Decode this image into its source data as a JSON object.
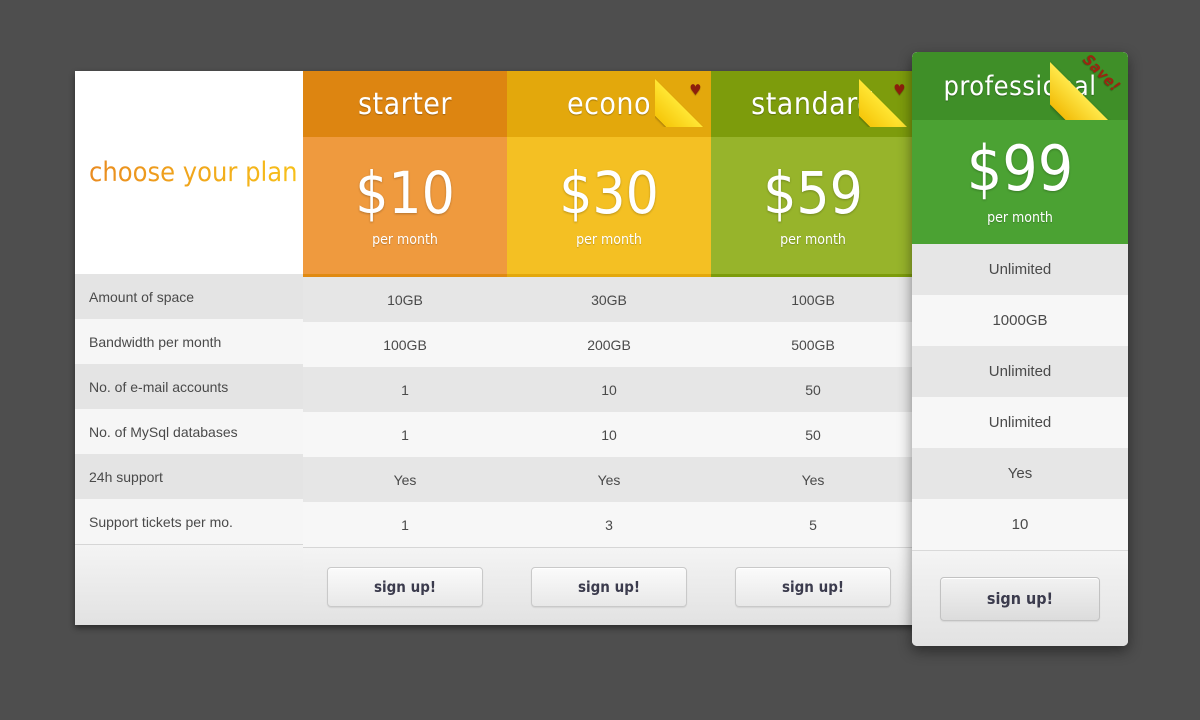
{
  "brand": {
    "title": "choose your plan"
  },
  "features": [
    "Amount of space",
    "Bandwidth per month",
    "No. of e-mail accounts",
    "No. of MySql databases",
    "24h support",
    "Support tickets per mo."
  ],
  "plans": [
    {
      "name": "starter",
      "price": "$10",
      "period": "per month",
      "signup_label": "sign up!",
      "ribbon": null,
      "values": [
        "10GB",
        "100GB",
        "1",
        "1",
        "Yes",
        "1"
      ],
      "header_color": "#dd8511",
      "price_color": "#ef9a3e",
      "accent_color": "#e08a12"
    },
    {
      "name": "econo",
      "price": "$30",
      "period": "per month",
      "signup_label": "sign up!",
      "ribbon": "heart",
      "values": [
        "30GB",
        "200GB",
        "10",
        "10",
        "Yes",
        "3"
      ],
      "header_color": "#e3a80c",
      "price_color": "#f4c023",
      "accent_color": "#e3a80c"
    },
    {
      "name": "standard",
      "price": "$59",
      "period": "per month",
      "signup_label": "sign up!",
      "ribbon": "heart",
      "values": [
        "100GB",
        "500GB",
        "50",
        "50",
        "Yes",
        "5"
      ],
      "header_color": "#7d9c0c",
      "price_color": "#97b42b",
      "accent_color": "#7d9c0c"
    }
  ],
  "featured_plan": {
    "name": "professional",
    "price": "$99",
    "period": "per month",
    "signup_label": "sign up!",
    "ribbon": "save",
    "ribbon_label": "Save!",
    "values": [
      "Unlimited",
      "1000GB",
      "Unlimited",
      "Unlimited",
      "Yes",
      "10"
    ],
    "header_color": "#3f8f28",
    "price_color": "#4ba233"
  },
  "icons": {
    "heart": "♥"
  }
}
